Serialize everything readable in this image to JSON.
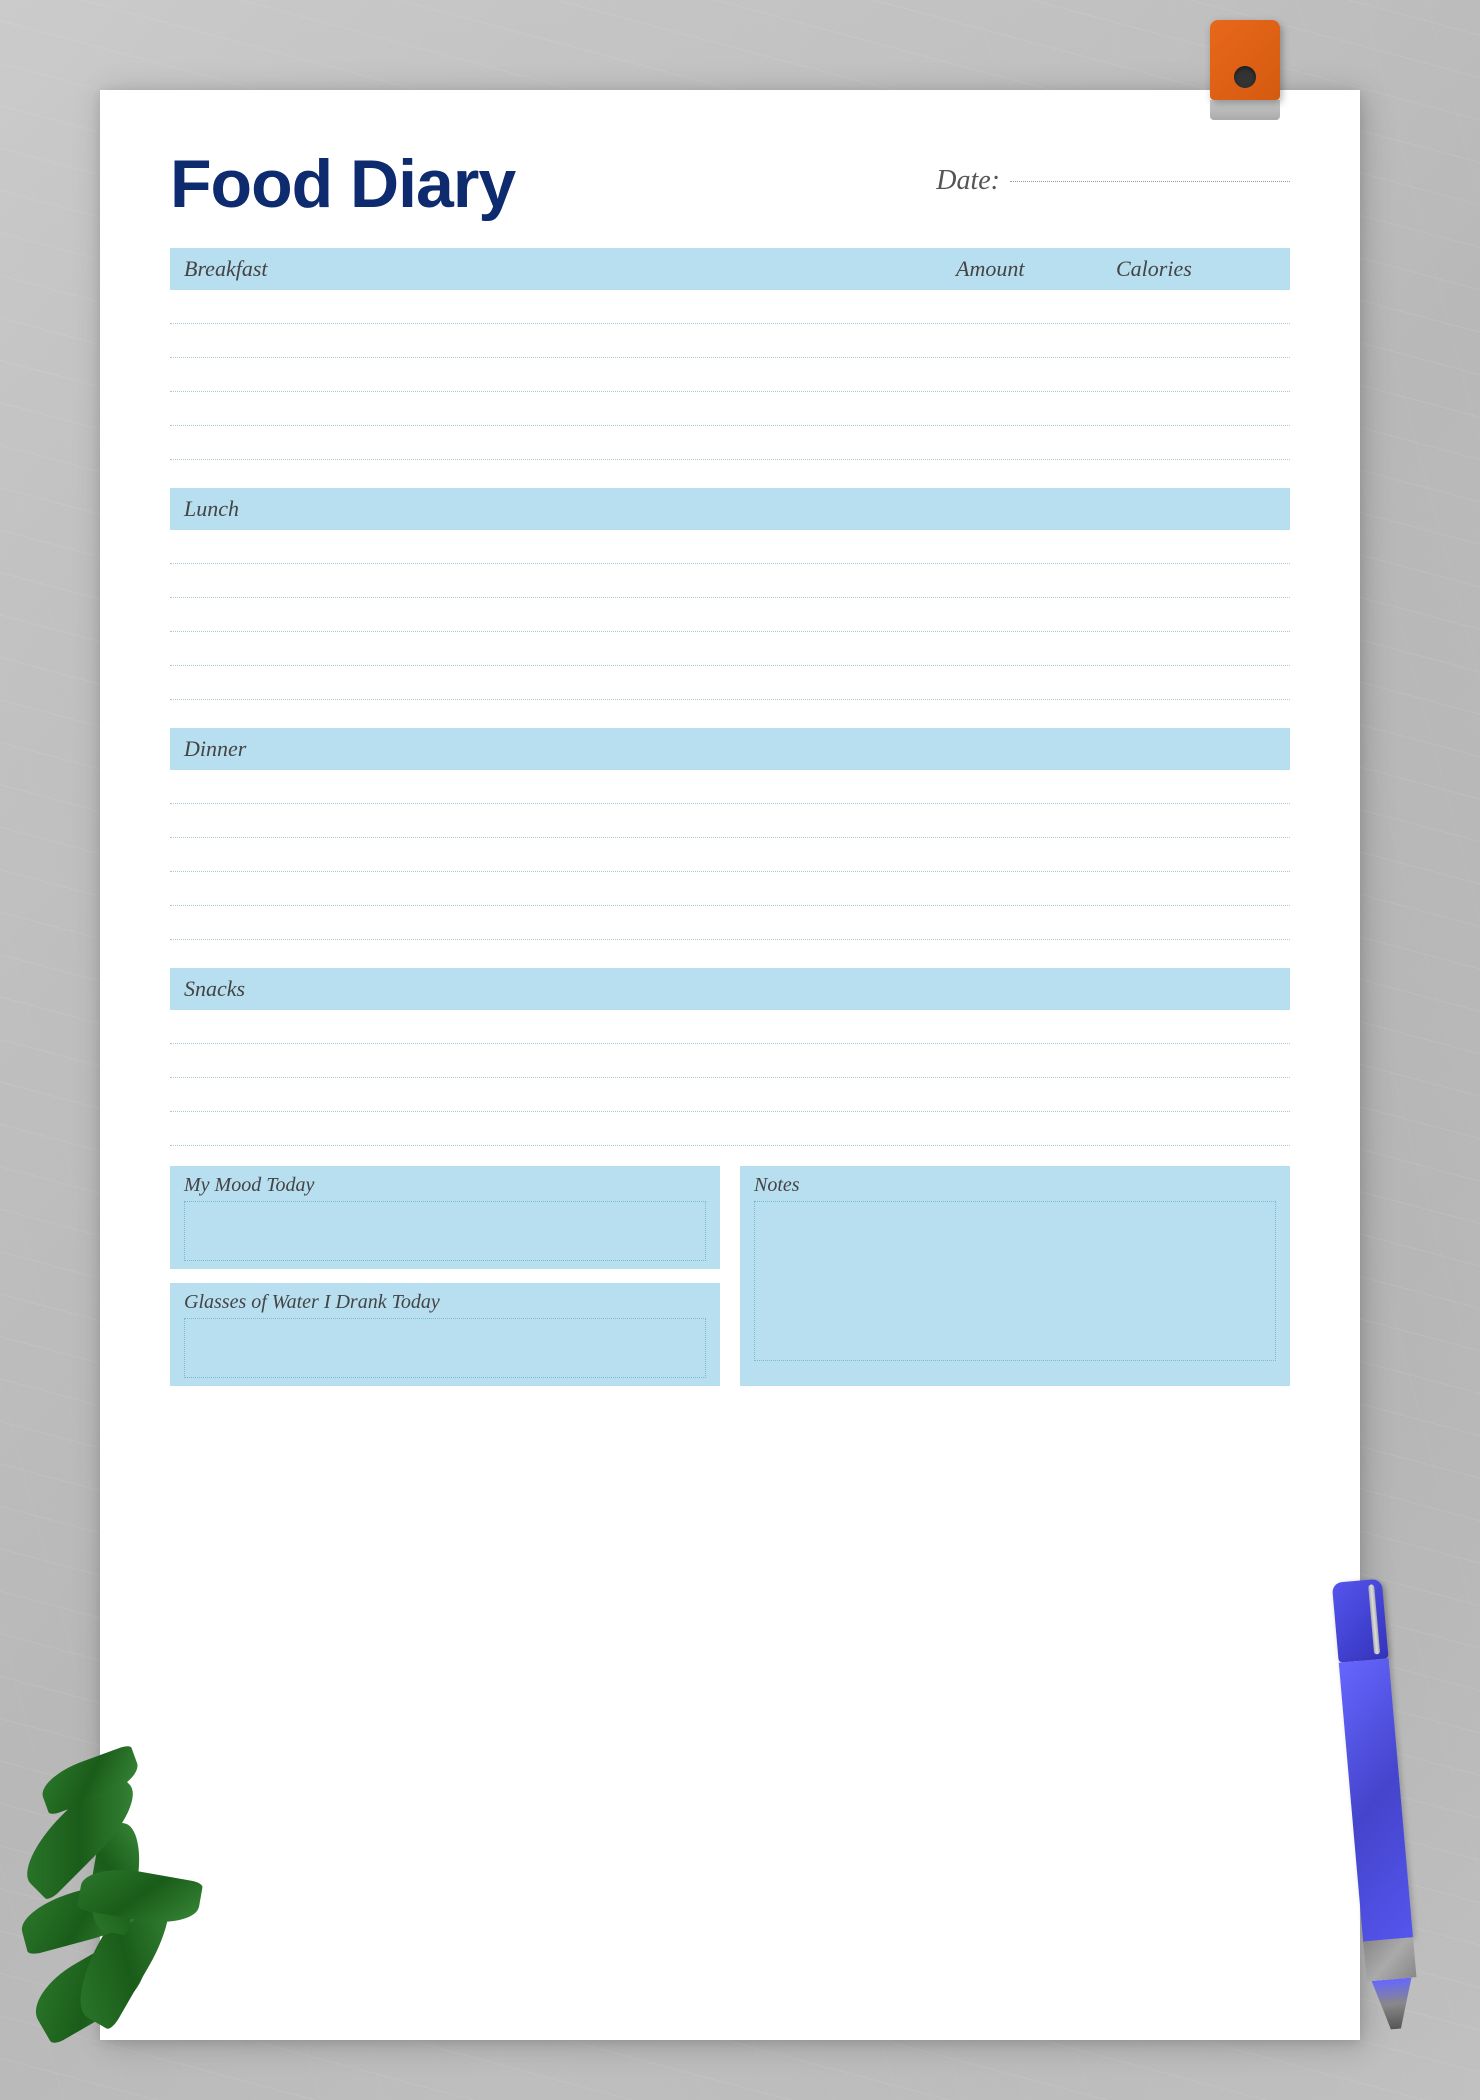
{
  "page": {
    "title": "Food Diary",
    "date_label": "Date:",
    "sections": [
      {
        "id": "breakfast",
        "label": "Breakfast",
        "amount_header": "Amount",
        "calories_header": "Calories",
        "rows": 5
      },
      {
        "id": "lunch",
        "label": "Lunch",
        "rows": 5
      },
      {
        "id": "dinner",
        "label": "Dinner",
        "rows": 5
      },
      {
        "id": "snacks",
        "label": "Snacks",
        "rows": 4
      }
    ],
    "mood_label": "My Mood Today",
    "water_label": "Glasses of Water I Drank Today",
    "notes_label": "Notes"
  }
}
